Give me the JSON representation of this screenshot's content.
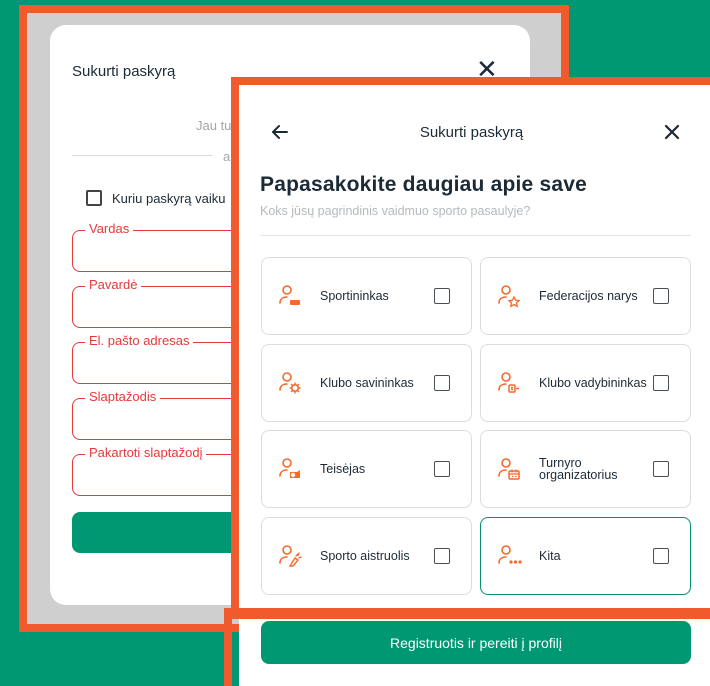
{
  "back": {
    "title": "Sukurti paskyrą",
    "close": "✕",
    "login_prompt": "Jau tu",
    "or_text": "a",
    "child_checkbox_label": "Kuriu paskyrą vaiku",
    "fields": [
      {
        "label": "Vardas"
      },
      {
        "label": "Pavardė"
      },
      {
        "label": "El. pašto adresas"
      },
      {
        "label": "Slaptažodis"
      },
      {
        "label": "Pakartoti slaptažodį"
      }
    ]
  },
  "modal": {
    "title": "Sukurti paskyrą",
    "heading": "Papasakokite daugiau apie save",
    "subheading": "Koks jūsų pagrindinis vaidmuo sporto pasaulyje?",
    "roles": [
      {
        "label": "Sportininkas",
        "icon": "athlete-icon"
      },
      {
        "label": "Federacijos narys",
        "icon": "federation-member-icon"
      },
      {
        "label": "Klubo savininkas",
        "icon": "club-owner-icon"
      },
      {
        "label": "Klubo vadybininkas",
        "icon": "club-manager-icon"
      },
      {
        "label": "Teisėjas",
        "icon": "referee-icon"
      },
      {
        "label": "Turnyro organizatorius",
        "icon": "tournament-organizer-icon"
      },
      {
        "label": "Sporto aistruolis",
        "icon": "sports-fan-icon"
      },
      {
        "label": "Kita",
        "icon": "other-icon"
      }
    ],
    "submit_label": "Registruotis ir pereiti į profilį"
  },
  "colors": {
    "background": "#009872",
    "accent_frame": "#f05a2c",
    "icon_orange": "#f26a2e",
    "primary_button": "#009872",
    "error_red": "#e53a3a"
  }
}
